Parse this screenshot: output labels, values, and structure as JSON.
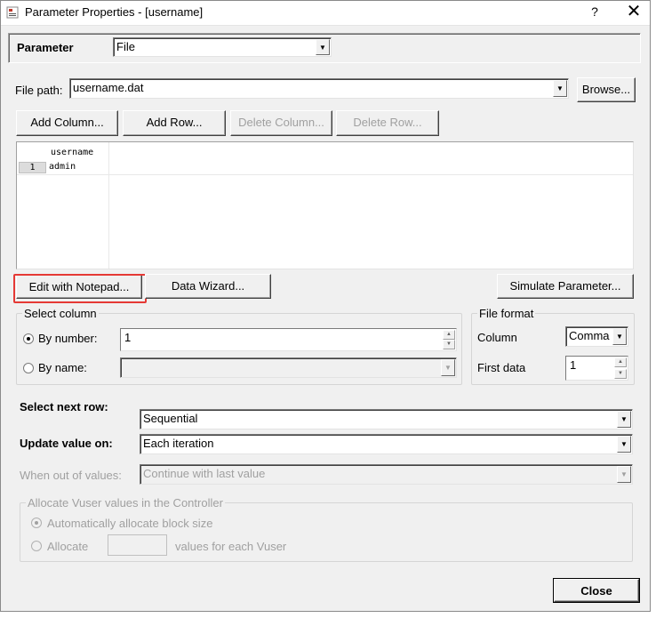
{
  "window": {
    "title": "Parameter Properties - [username]",
    "help_label": "?",
    "close_glyph": "✕"
  },
  "parameter": {
    "label": "Parameter",
    "type_value": "File"
  },
  "file_path": {
    "label": "File path:",
    "value": "username.dat",
    "browse_label": "Browse..."
  },
  "table_buttons": {
    "add_column": "Add Column...",
    "add_row": "Add Row...",
    "delete_column": "Delete Column...",
    "delete_row": "Delete Row..."
  },
  "grid": {
    "columns": [
      "username"
    ],
    "rows": [
      {
        "num": "1",
        "cells": [
          "admin"
        ]
      }
    ]
  },
  "action_buttons": {
    "edit_notepad": "Edit with Notepad...",
    "data_wizard": "Data Wizard...",
    "simulate": "Simulate Parameter..."
  },
  "select_column": {
    "title": "Select column",
    "by_number_label": "By number:",
    "by_number_value": "1",
    "by_name_label": "By name:",
    "by_name_value": ""
  },
  "file_format": {
    "title": "File format",
    "column_label": "Column",
    "column_value": "Comma",
    "first_data_label": "First data",
    "first_data_value": "1"
  },
  "row_options": {
    "select_next_row_label": "Select next row:",
    "select_next_row_value": "Sequential",
    "update_value_on_label": "Update value on:",
    "update_value_on_value": "Each iteration",
    "when_out_label": "When out of values:",
    "when_out_value": "Continue with last value"
  },
  "allocate": {
    "title": "Allocate Vuser values in the Controller",
    "auto_label": "Automatically allocate block size",
    "allocate_label": "Allocate",
    "allocate_value": "",
    "per_vuser_label": "values for each Vuser"
  },
  "footer": {
    "close_label": "Close"
  },
  "accent": {
    "highlight_box": "#e53935"
  }
}
